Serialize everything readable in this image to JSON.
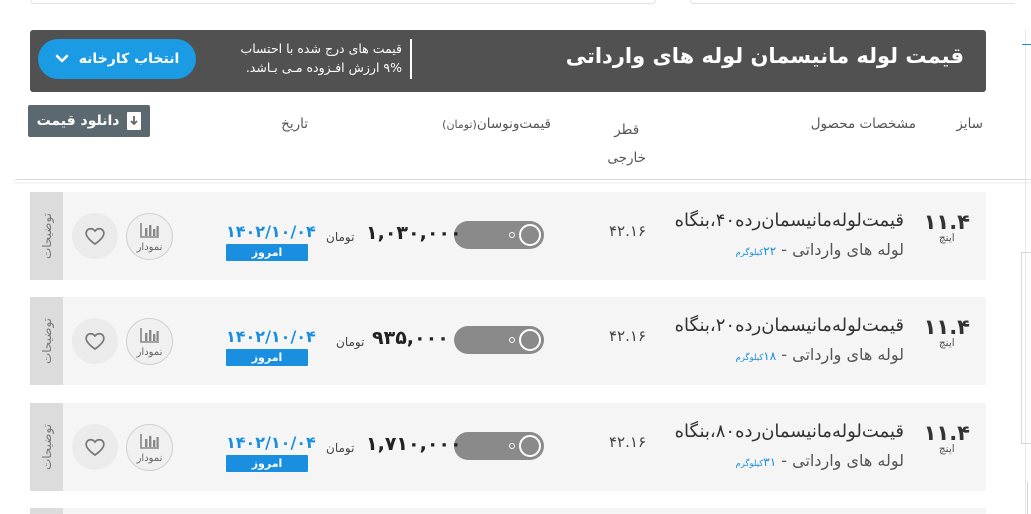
{
  "header": {
    "title": "قیمت لوله مانیسمان لوله های وارداتی",
    "note_line1": "قیمت های درج شده با احتساب",
    "note_line2": "۹% ارزش افـزوده مـی بـاشد.",
    "factory_button": "انتخاب کارخانه"
  },
  "toolbar": {
    "download_label": "دانلود قیمت"
  },
  "columns": {
    "size": "سایز",
    "spec": "مشخصات محصول",
    "diameter_line1": "قطر",
    "diameter_line2": "خارجی",
    "price": "قیمت‌ونوسان",
    "price_unit": "(تومان)",
    "date": "تاریخ"
  },
  "rows": [
    {
      "side_label": "توضیحات",
      "size": "۱۱.۴",
      "size_unit": "اینچ",
      "name": "قیمت‌لوله‌مانیسمان‌رده۴۰،بنگاه",
      "subtitle": "لوله های وارداتی - ",
      "weight": "۲۲",
      "weight_unit": "کیلوگرم",
      "diameter": "۴۲.۱۶",
      "price": "۱,۰۳۰,۰۰۰",
      "currency": "تومان",
      "date": "۱۴۰۲/۱۰/۰۴",
      "badge": "امروز",
      "chart_label": "نمودار"
    },
    {
      "side_label": "توضیحات",
      "size": "۱۱.۴",
      "size_unit": "اینچ",
      "name": "قیمت‌لوله‌مانیسمان‌رده۲۰،بنگاه",
      "subtitle": "لوله های وارداتی - ",
      "weight": "۱۸",
      "weight_unit": "کیلوگرم",
      "diameter": "۴۲.۱۶",
      "price": "۹۳۵,۰۰۰",
      "currency": "تومان",
      "date": "۱۴۰۲/۱۰/۰۴",
      "badge": "امروز",
      "chart_label": "نمودار"
    },
    {
      "side_label": "توضیحات",
      "size": "۱۱.۴",
      "size_unit": "اینچ",
      "name": "قیمت‌لوله‌مانیسمان‌رده۸۰،بنگاه",
      "subtitle": "لوله های وارداتی - ",
      "weight": "۳۱",
      "weight_unit": "کیلوگرم",
      "diameter": "۴۲.۱۶",
      "price": "۱,۷۱۰,۰۰۰",
      "currency": "تومان",
      "date": "۱۴۰۲/۱۰/۰۴",
      "badge": "امروز",
      "chart_label": "نمودار"
    }
  ],
  "icons": {
    "chevron": "chevron-down-icon",
    "download": "download-icon",
    "chart": "bar-chart-icon",
    "favorite": "heart-icon"
  },
  "colors": {
    "header_bg": "#515151",
    "accent_blue": "#1a9be4",
    "row_bg": "#f5f5f5",
    "side_tab": "#dcdcdc",
    "toggle_bg": "#8a8a8a"
  }
}
